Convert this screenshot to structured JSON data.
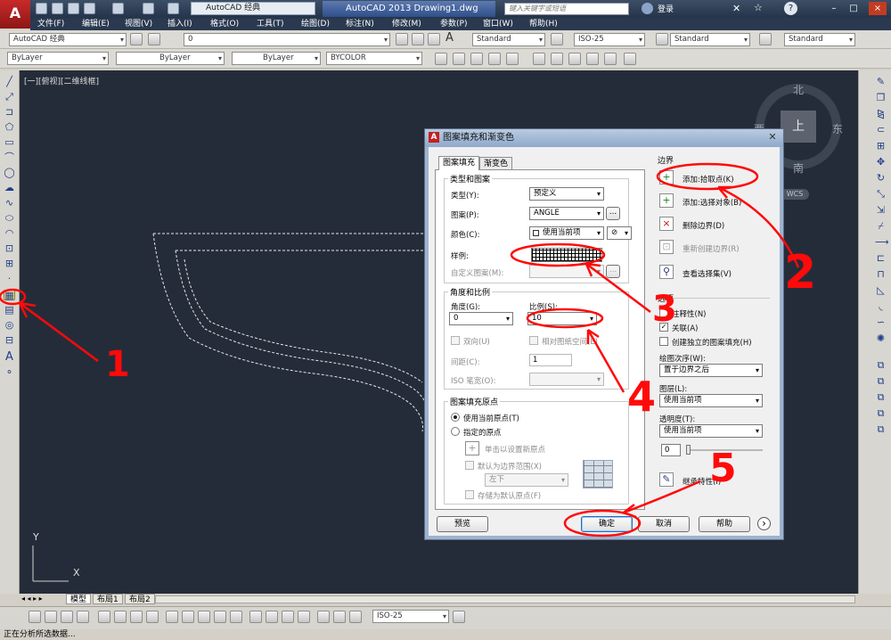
{
  "app": {
    "logo_text": "A",
    "title": "AutoCAD 2013    Drawing1.dwg",
    "workspace": "AutoCAD 经典",
    "search_placeholder": "键入关键字或短语",
    "login": "登录",
    "window_buttons": [
      "–",
      "□",
      "×"
    ]
  },
  "menu": [
    "文件(F)",
    "编辑(E)",
    "视图(V)",
    "插入(I)",
    "格式(O)",
    "工具(T)",
    "绘图(D)",
    "标注(N)",
    "修改(M)",
    "参数(P)",
    "窗口(W)",
    "帮助(H)"
  ],
  "toolbar": {
    "workspace_combo": "AutoCAD 经典",
    "layer_combo": "0",
    "text_style": "Standard",
    "dim_style": "ISO-25",
    "table_style": "Standard",
    "mleader_style": "Standard",
    "color_combo": "ByLayer",
    "linetype_combo": "ByLayer",
    "lineweight_combo": "ByLayer",
    "plotstyle_combo": "BYCOLOR"
  },
  "viewport": {
    "label": "[一][俯视][二维线框]",
    "compass": {
      "north": "北",
      "south": "南",
      "east": "东",
      "west": "西",
      "top": "上",
      "wcs": "WCS"
    },
    "ucs_x": "X",
    "ucs_y": "Y"
  },
  "layout_tabs": [
    "模型",
    "布局1",
    "布局2"
  ],
  "bottom_dim_style": "ISO-25",
  "status_text": "正在分析所选数据...",
  "dialog": {
    "title": "图案填充和渐变色",
    "tabs": [
      "图案填充",
      "渐变色"
    ],
    "type_pattern": {
      "group": "类型和图案",
      "type_label": "类型(Y):",
      "type_value": "预定义",
      "pattern_label": "图案(P):",
      "pattern_value": "ANGLE",
      "color_label": "颜色(C):",
      "color_value": "使用当前项",
      "swatch_label": "样例:",
      "custom_label": "自定义图案(M):"
    },
    "angle_scale": {
      "group": "角度和比例",
      "angle_label": "角度(G):",
      "angle_value": "0",
      "scale_label": "比例(S):",
      "scale_value": "10",
      "double_label": "双向(U)",
      "relative_label": "相对图纸空间(E)",
      "spacing_label": "间距(C):",
      "spacing_value": "1",
      "iso_label": "ISO 笔宽(O):"
    },
    "origin": {
      "group": "图案填充原点",
      "use_current": "使用当前原点(T)",
      "specified": "指定的原点",
      "click_set": "单击以设置新原点",
      "default_extent": "默认为边界范围(X)",
      "position": "左下",
      "store_default": "存储为默认原点(F)"
    },
    "boundaries": {
      "group": "边界",
      "add_pick": "添加:拾取点(K)",
      "add_select": "添加:选择对象(B)",
      "remove": "删除边界(D)",
      "recreate": "重新创建边界(R)",
      "view_selections": "查看选择集(V)"
    },
    "options": {
      "group": "选项",
      "annotative": "注释性(N)",
      "associative": "关联(A)",
      "separate": "创建独立的图案填充(H)",
      "draw_order_label": "绘图次序(W):",
      "draw_order_value": "置于边界之后",
      "layer_label": "图层(L):",
      "layer_value": "使用当前项",
      "transparency_label": "透明度(T):",
      "transparency_value": "使用当前项",
      "transparency_amount": "0"
    },
    "inherit": "继承特性(I)",
    "buttons": {
      "preview": "预览",
      "ok": "确定",
      "cancel": "取消",
      "help": "帮助",
      "more": "›"
    }
  },
  "annotations": [
    "1",
    "2",
    "3",
    "4",
    "5"
  ],
  "colors": {
    "canvas": "#252c39",
    "annotation": "#ff0a0a",
    "accent": "#3d4f66"
  }
}
